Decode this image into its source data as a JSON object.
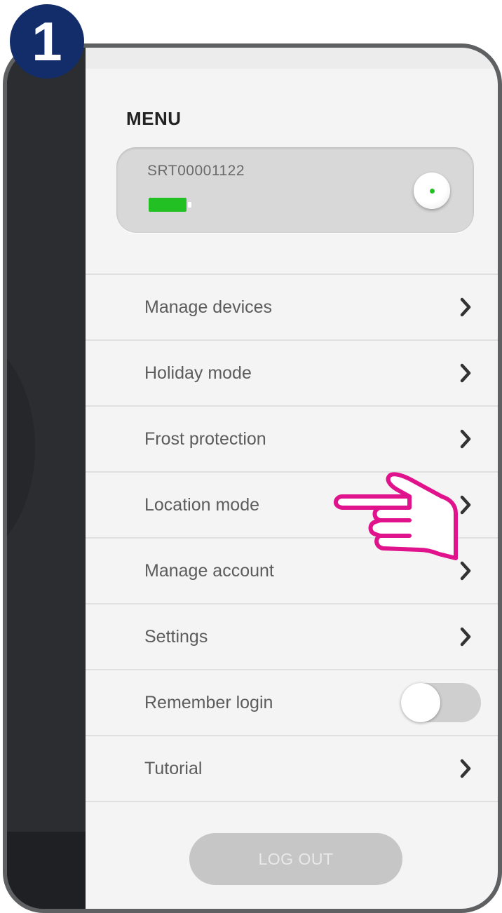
{
  "step_badge": {
    "number": "1",
    "color": "#132d6b"
  },
  "menu": {
    "title": "MENU",
    "device": {
      "id": "SRT00001122",
      "battery_level": 1.0,
      "battery_color": "#22c022",
      "status_led_color": "#22c022"
    },
    "items": [
      {
        "label": "Manage devices",
        "icon": "chevron-right-icon"
      },
      {
        "label": "Holiday mode",
        "icon": "chevron-right-icon"
      },
      {
        "label": "Frost protection",
        "icon": "chevron-right-icon"
      },
      {
        "label": "Location mode",
        "icon": "chevron-right-icon"
      },
      {
        "label": "Manage account",
        "icon": "chevron-right-icon"
      },
      {
        "label": "Settings",
        "icon": "chevron-right-icon"
      },
      {
        "label": "Remember login",
        "toggle_on": false
      },
      {
        "label": "Tutorial",
        "icon": "chevron-right-icon"
      }
    ],
    "logout_label": "LOG OUT"
  },
  "annotation": {
    "icon": "pointing-hand-icon",
    "color": "#e0138c",
    "target": "Location mode"
  }
}
